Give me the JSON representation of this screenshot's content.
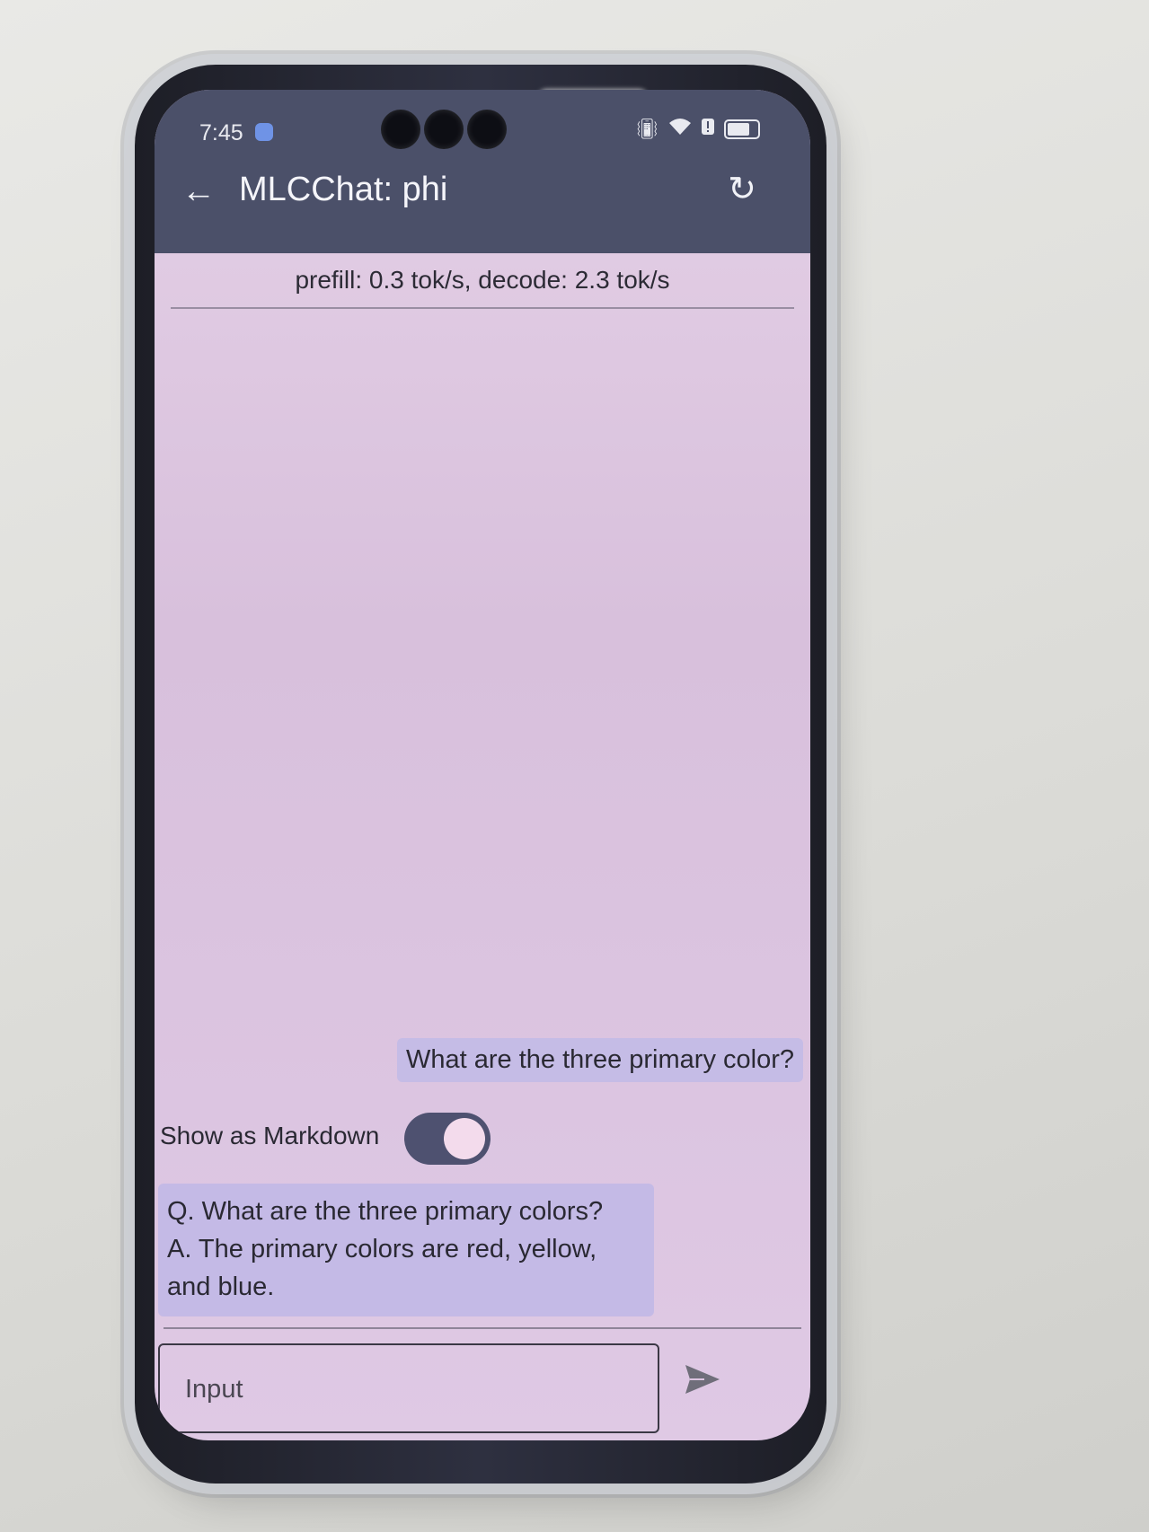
{
  "status_bar": {
    "time": "7:45",
    "icons": [
      "vibrate-icon",
      "wifi-icon",
      "alert-icon",
      "battery-icon"
    ]
  },
  "app_bar": {
    "title": "MLCChat: phi",
    "back_icon": "arrow-left-icon",
    "reset_icon": "refresh-icon"
  },
  "stats": {
    "text": "prefill: 0.3 tok/s, decode: 2.3 tok/s"
  },
  "chat": {
    "messages": [
      {
        "role": "user",
        "text": "What are the three primary color?"
      },
      {
        "role": "assistant",
        "text": "Q. What are the three primary colors?\nA. The primary colors are red, yellow, and blue."
      }
    ],
    "markdown_toggle": {
      "label": "Show as Markdown",
      "on": true
    }
  },
  "composer": {
    "placeholder": "Input",
    "send_icon": "send-icon"
  },
  "colors": {
    "app_bar": "#4b5069",
    "screen_bg": "#dcc5e1",
    "bubble": "#c5bce6",
    "toggle_track": "#4e5170"
  }
}
